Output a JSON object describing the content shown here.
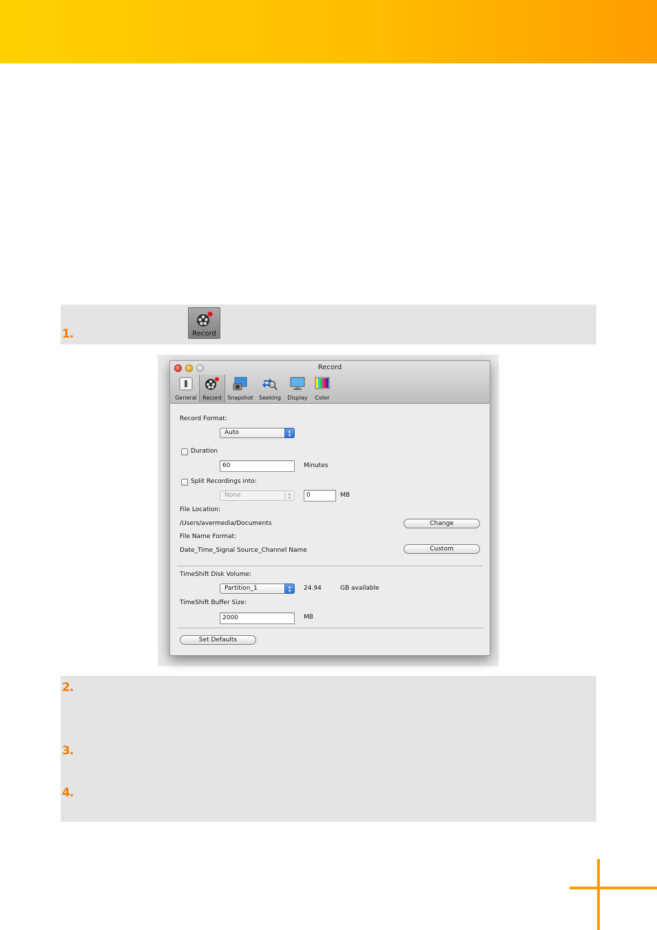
{
  "steps": [
    "1.",
    "2.",
    "3.",
    "4."
  ],
  "record_button": {
    "label": "Record",
    "icon": "film-reel-icon"
  },
  "window": {
    "title": "Record",
    "toolbar": [
      {
        "label": "General",
        "icon": "switch-icon"
      },
      {
        "label": "Record",
        "icon": "film-reel-icon"
      },
      {
        "label": "Snapshot",
        "icon": "camera-icon"
      },
      {
        "label": "Seeking",
        "icon": "seek-magnifier-icon"
      },
      {
        "label": "Display",
        "icon": "monitor-icon"
      },
      {
        "label": "Color",
        "icon": "color-bars-icon"
      }
    ],
    "record_format_label": "Record Format:",
    "record_format_value": "Auto",
    "duration_label": "Duration",
    "duration_value": "60",
    "duration_unit": "Minutes",
    "split_label": "Split Recordings into:",
    "split_select_value": "None",
    "split_size_value": "0",
    "split_unit": "MB",
    "file_location_label": "File Location:",
    "file_location_value": "/Users/avermedia/Documents",
    "change_button": "Change",
    "file_name_format_label": "File Name Format:",
    "file_name_format_value": "Date_Time_Signal Source_Channel Name",
    "custom_button": "Custom",
    "timeshift_volume_label": "TimeShift Disk Volume:",
    "timeshift_volume_value": "Partition_1",
    "available_value": "24.94",
    "available_unit": "GB available",
    "buffer_label": "TimeShift Buffer Size:",
    "buffer_value": "2000",
    "buffer_unit": "MB",
    "set_defaults_button": "Set Defaults"
  },
  "colors": {
    "banner_start": "#ffd000",
    "banner_end": "#ff9d00",
    "accent": "#f07c00",
    "panel_gray": "#e4e4e4"
  }
}
